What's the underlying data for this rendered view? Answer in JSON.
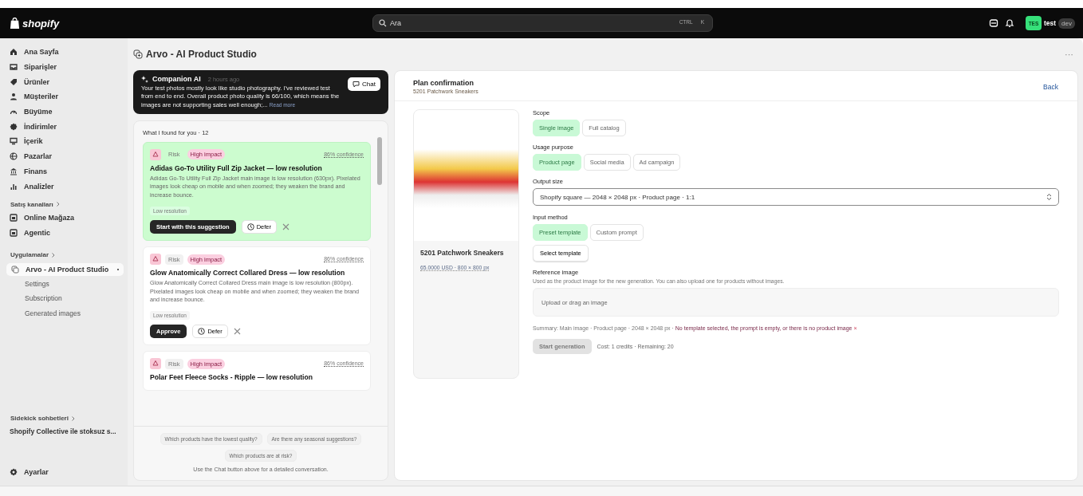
{
  "topbar": {
    "logo": "shopify",
    "search": {
      "placeholder": "Ara",
      "keys": [
        "CTRL",
        "K"
      ]
    },
    "user": {
      "avatar": "TES",
      "name": "test",
      "badge": "dev"
    }
  },
  "sidebar": {
    "items": [
      {
        "label": "Ana Sayfa"
      },
      {
        "label": "Siparişler"
      },
      {
        "label": "Ürünler"
      },
      {
        "label": "Müşteriler"
      },
      {
        "label": "Büyüme"
      },
      {
        "label": "İndirimler"
      },
      {
        "label": "İçerik"
      },
      {
        "label": "Pazarlar"
      },
      {
        "label": "Finans"
      },
      {
        "label": "Analizler"
      }
    ],
    "sales_channels": {
      "heading": "Satış kanalları",
      "items": [
        {
          "label": "Online Mağaza"
        },
        {
          "label": "Agentic"
        }
      ]
    },
    "apps": {
      "heading": "Uygulamalar",
      "items": [
        {
          "label": "Arvo - AI Product Studio",
          "selected": true,
          "children": [
            {
              "label": "Settings"
            },
            {
              "label": "Subscription"
            },
            {
              "label": "Generated images"
            }
          ]
        }
      ]
    },
    "sidekick": {
      "heading": "Sidekick sohbetleri",
      "items": [
        {
          "label": "Shopify Collective ile stoksuz s..."
        }
      ]
    },
    "footer": {
      "label": "Ayarlar"
    }
  },
  "page": {
    "title": "Arvo - AI Product Studio",
    "more": "···"
  },
  "companion": {
    "title": "Companion AI",
    "time": "2 hours ago",
    "text": "Your test photos mostly look like studio photography. I've reviewed test from end to end. Overall product photo quality is 66/100, which means the images are not supporting sales well enough;...",
    "read_more": "Read more",
    "chat_button": "Chat"
  },
  "findings": {
    "heading": "What I found for you · 12",
    "cards": [
      {
        "selected": true,
        "type": "Risk",
        "impact": "High impact",
        "confidence": "86% confidence",
        "title": "Adidas Go-To Utility Full Zip Jacket — low resolution",
        "description": "Adidas Go-To Utility Full Zip Jacket main image is low resolution (630px). Pixelated images look cheap on mobile and when zoomed; they weaken the brand and increase bounce.",
        "tag": "Low resolution",
        "primary": "Start with this suggestion",
        "defer": "Defer"
      },
      {
        "selected": false,
        "type": "Risk",
        "impact": "High impact",
        "confidence": "86% confidence",
        "title": "Glow Anatomically Correct Collared Dress — low resolution",
        "description": "Glow Anatomically Correct Collared Dress main image is low resolution (800px). Pixelated images look cheap on mobile and when zoomed; they weaken the brand and increase bounce.",
        "tag": "Low resolution",
        "primary": "Approve",
        "defer": "Defer"
      },
      {
        "selected": false,
        "type": "Risk",
        "impact": "High impact",
        "confidence": "86% confidence",
        "title": "Polar Feet Fleece Socks - Ripple — low resolution"
      }
    ],
    "questions": [
      "Which products have the lowest quality?",
      "Are there any seasonal suggestions?",
      "Which products are at risk?"
    ],
    "note": "Use the Chat button above for a detailed conversation."
  },
  "plan": {
    "title": "Plan confirmation",
    "subtitle": "5201 Patchwork Sneakers",
    "back": "Back",
    "product": {
      "name": "5201 Patchwork Sneakers",
      "meta": "65.0000 USD · 800 × 800 px"
    },
    "scope": {
      "label": "Scope",
      "options": [
        {
          "label": "Single image",
          "selected": true
        },
        {
          "label": "Full catalog",
          "selected": false
        }
      ]
    },
    "usage": {
      "label": "Usage purpose",
      "options": [
        {
          "label": "Product page",
          "selected": true
        },
        {
          "label": "Social media",
          "selected": false
        },
        {
          "label": "Ad campaign",
          "selected": false
        }
      ]
    },
    "output": {
      "label": "Output size",
      "value": "Shopify square — 2048 × 2048 px · Product page · 1:1"
    },
    "input_method": {
      "label": "Input method",
      "options": [
        {
          "label": "Preset template",
          "selected": true
        },
        {
          "label": "Custom prompt",
          "selected": false
        }
      ]
    },
    "select_template": "Select template",
    "reference": {
      "label": "Reference image",
      "hint": "Used as the product image for the new generation. You can also upload one for products without images.",
      "placeholder": "Upload or drag an image"
    },
    "summary": {
      "text": "Summary: Main image · Product page · 2048 × 2048 px · ",
      "error": "No template selected, the prompt is empty, or there is no product image",
      "dismiss": "×"
    },
    "start": {
      "label": "Start generation",
      "disabled": true
    },
    "cost": "Cost: 1 credits · Remaining: 20"
  }
}
